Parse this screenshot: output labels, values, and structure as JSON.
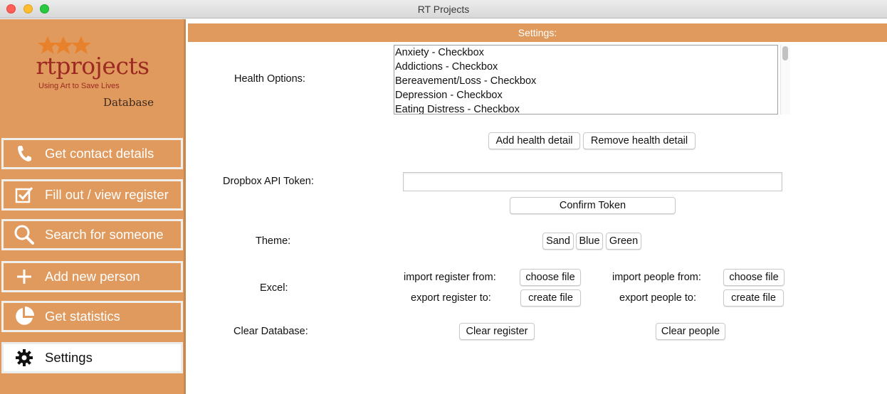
{
  "window": {
    "title": "RT Projects"
  },
  "logo": {
    "wordmark": "rtprojects",
    "tagline": "Using Art to Save Lives",
    "subtitle": "Database"
  },
  "sidebar": {
    "items": [
      {
        "label": "Get contact details",
        "icon": "phone-icon"
      },
      {
        "label": "Fill out / view register",
        "icon": "checkbox-icon"
      },
      {
        "label": "Search for someone",
        "icon": "search-icon"
      },
      {
        "label": "Add new person",
        "icon": "plus-icon"
      },
      {
        "label": "Get statistics",
        "icon": "pie-chart-icon"
      },
      {
        "label": "Settings",
        "icon": "gear-icon",
        "active": true
      }
    ]
  },
  "settings": {
    "header": "Settings:",
    "health": {
      "label": "Health Options:",
      "items": [
        "Anxiety - Checkbox",
        "Addictions - Checkbox",
        "Bereavement/Loss - Checkbox",
        "Depression - Checkbox",
        "Eating Distress - Checkbox"
      ],
      "add_button": "Add health detail",
      "remove_button": "Remove health detail"
    },
    "dropbox": {
      "label": "Dropbox API Token:",
      "value": "",
      "confirm_button": "Confirm Token"
    },
    "theme": {
      "label": "Theme:",
      "options": [
        "Sand",
        "Blue",
        "Green"
      ]
    },
    "excel": {
      "label": "Excel:",
      "import_register_label": "import register from:",
      "import_register_button": "choose file",
      "export_register_label": "export register to:",
      "export_register_button": "create file",
      "import_people_label": "import people from:",
      "import_people_button": "choose file",
      "export_people_label": "export people to:",
      "export_people_button": "create file"
    },
    "clear": {
      "label": "Clear Database:",
      "register_button": "Clear register",
      "people_button": "Clear people"
    }
  },
  "colors": {
    "accent": "#e09a5e",
    "logo_red": "#9c2a22",
    "star_orange": "#e8812c"
  }
}
